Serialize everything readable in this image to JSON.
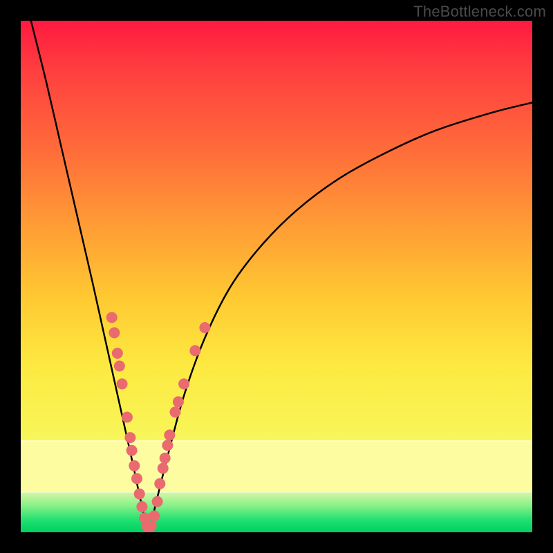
{
  "watermark": "TheBottleneck.com",
  "chart_data": {
    "type": "line",
    "title": "",
    "xlabel": "",
    "ylabel": "",
    "xlim": [
      0,
      100
    ],
    "ylim": [
      0,
      100
    ],
    "grid": false,
    "legend": {
      "position": "none"
    },
    "background_zones": [
      {
        "name": "red-yellow-gradient",
        "from_pct": 0,
        "to_pct": 82,
        "color_top": "#ff1a40",
        "color_bottom": "#f8f65a"
      },
      {
        "name": "pale-yellow-band",
        "from_pct": 82,
        "to_pct": 92,
        "color": "#fdfca0"
      },
      {
        "name": "green-gradient",
        "from_pct": 92,
        "to_pct": 100,
        "color_top": "#d8f8a8",
        "color_bottom": "#00d060"
      }
    ],
    "series": [
      {
        "name": "bottleneck-curve",
        "stroke": "#000000",
        "stroke_width": 2.5,
        "x": [
          2,
          5,
          8,
          11,
          14,
          16,
          18,
          20,
          22,
          23.5,
          25,
          26.5,
          29,
          32,
          36,
          41,
          47,
          54,
          62,
          71,
          81,
          92,
          100
        ],
        "values": [
          100,
          88,
          75,
          62,
          49,
          40,
          31,
          22,
          13,
          6,
          0.5,
          6,
          16,
          27,
          38,
          48,
          56,
          63,
          69,
          74,
          78.5,
          82,
          84
        ]
      }
    ],
    "markers": {
      "name": "sample-points",
      "color": "#e96a6f",
      "radius": 8,
      "points": [
        {
          "x": 17.8,
          "y_pct": 42
        },
        {
          "x": 18.3,
          "y_pct": 39
        },
        {
          "x": 18.9,
          "y_pct": 35
        },
        {
          "x": 19.3,
          "y_pct": 32.5
        },
        {
          "x": 19.8,
          "y_pct": 29
        },
        {
          "x": 20.8,
          "y_pct": 22.5
        },
        {
          "x": 21.4,
          "y_pct": 18.5
        },
        {
          "x": 21.7,
          "y_pct": 16
        },
        {
          "x": 22.2,
          "y_pct": 13
        },
        {
          "x": 22.7,
          "y_pct": 10.5
        },
        {
          "x": 23.2,
          "y_pct": 7.5
        },
        {
          "x": 23.7,
          "y_pct": 5
        },
        {
          "x": 24.2,
          "y_pct": 2.8
        },
        {
          "x": 24.7,
          "y_pct": 1.2
        },
        {
          "x": 25.0,
          "y_pct": 0.5
        },
        {
          "x": 25.5,
          "y_pct": 1.2
        },
        {
          "x": 26.1,
          "y_pct": 3.2
        },
        {
          "x": 26.7,
          "y_pct": 6
        },
        {
          "x": 27.2,
          "y_pct": 9.5
        },
        {
          "x": 27.8,
          "y_pct": 12.5
        },
        {
          "x": 28.2,
          "y_pct": 14.5
        },
        {
          "x": 28.7,
          "y_pct": 17
        },
        {
          "x": 29.1,
          "y_pct": 19
        },
        {
          "x": 30.2,
          "y_pct": 23.5
        },
        {
          "x": 30.8,
          "y_pct": 25.5
        },
        {
          "x": 31.9,
          "y_pct": 29
        },
        {
          "x": 34.1,
          "y_pct": 35.5
        },
        {
          "x": 36.0,
          "y_pct": 40
        }
      ]
    }
  }
}
